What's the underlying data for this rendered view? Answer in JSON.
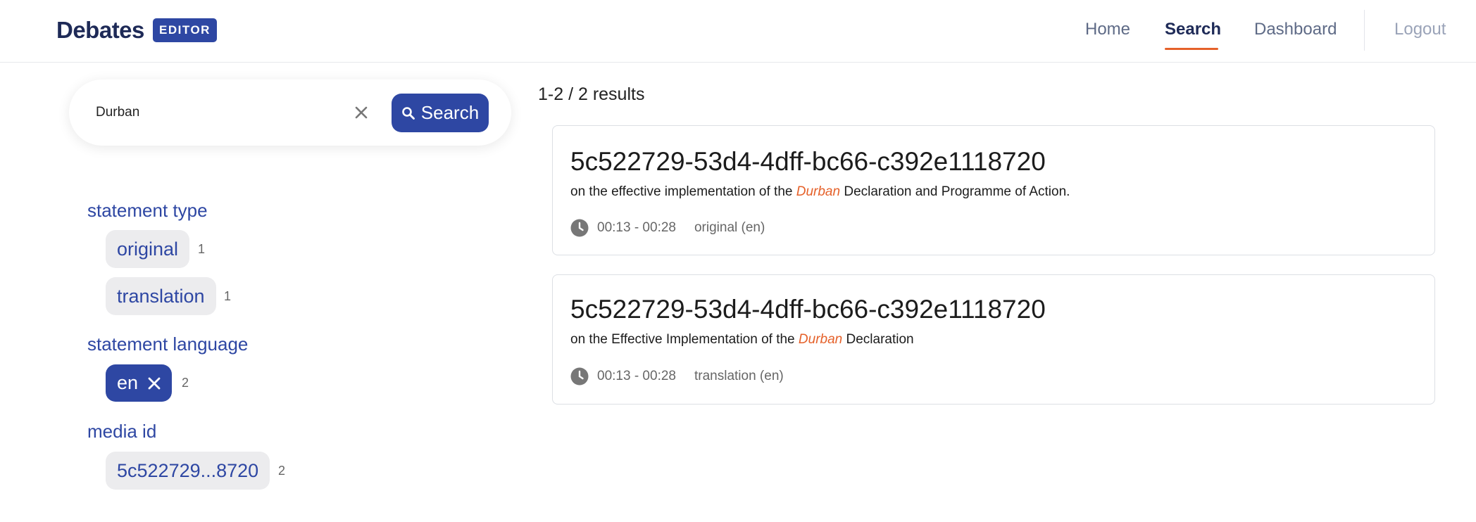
{
  "header": {
    "brand": "Debates",
    "role_badge": "EDITOR",
    "nav": {
      "home": "Home",
      "search": "Search",
      "dashboard": "Dashboard",
      "logout": "Logout"
    },
    "active_nav": "Search"
  },
  "search": {
    "query": "Durban",
    "button_label": "Search",
    "clear_icon": "close-icon",
    "button_icon": "search-icon"
  },
  "facets": {
    "statement_type": {
      "title": "statement type",
      "options": [
        {
          "label": "original",
          "count": "1"
        },
        {
          "label": "translation",
          "count": "1"
        }
      ]
    },
    "statement_language": {
      "title": "statement language",
      "options": [
        {
          "label": "en",
          "count": "2",
          "selected": true
        }
      ]
    },
    "media_id": {
      "title": "media id",
      "options": [
        {
          "label": "5c522729...8720",
          "count": "2"
        }
      ]
    }
  },
  "results": {
    "count_text": "1-2 / 2 results",
    "items": [
      {
        "title": "5c522729-53d4-4dff-bc66-c392e1118720",
        "snippet_before": "on the effective implementation of the ",
        "snippet_highlight": "Durban",
        "snippet_after": " Declaration and Programme of Action.",
        "time": "00:13 - 00:28",
        "lang": "original (en)"
      },
      {
        "title": "5c522729-53d4-4dff-bc66-c392e1118720",
        "snippet_before": "on the Effective Implementation of the ",
        "snippet_highlight": "Durban",
        "snippet_after": " Declaration",
        "time": "00:13 - 00:28",
        "lang": "translation (en)"
      }
    ]
  },
  "colors": {
    "primary": "#2e47a3",
    "brand_text": "#1e2a57",
    "accent": "#e5612a",
    "chip_bg": "#ececee"
  }
}
